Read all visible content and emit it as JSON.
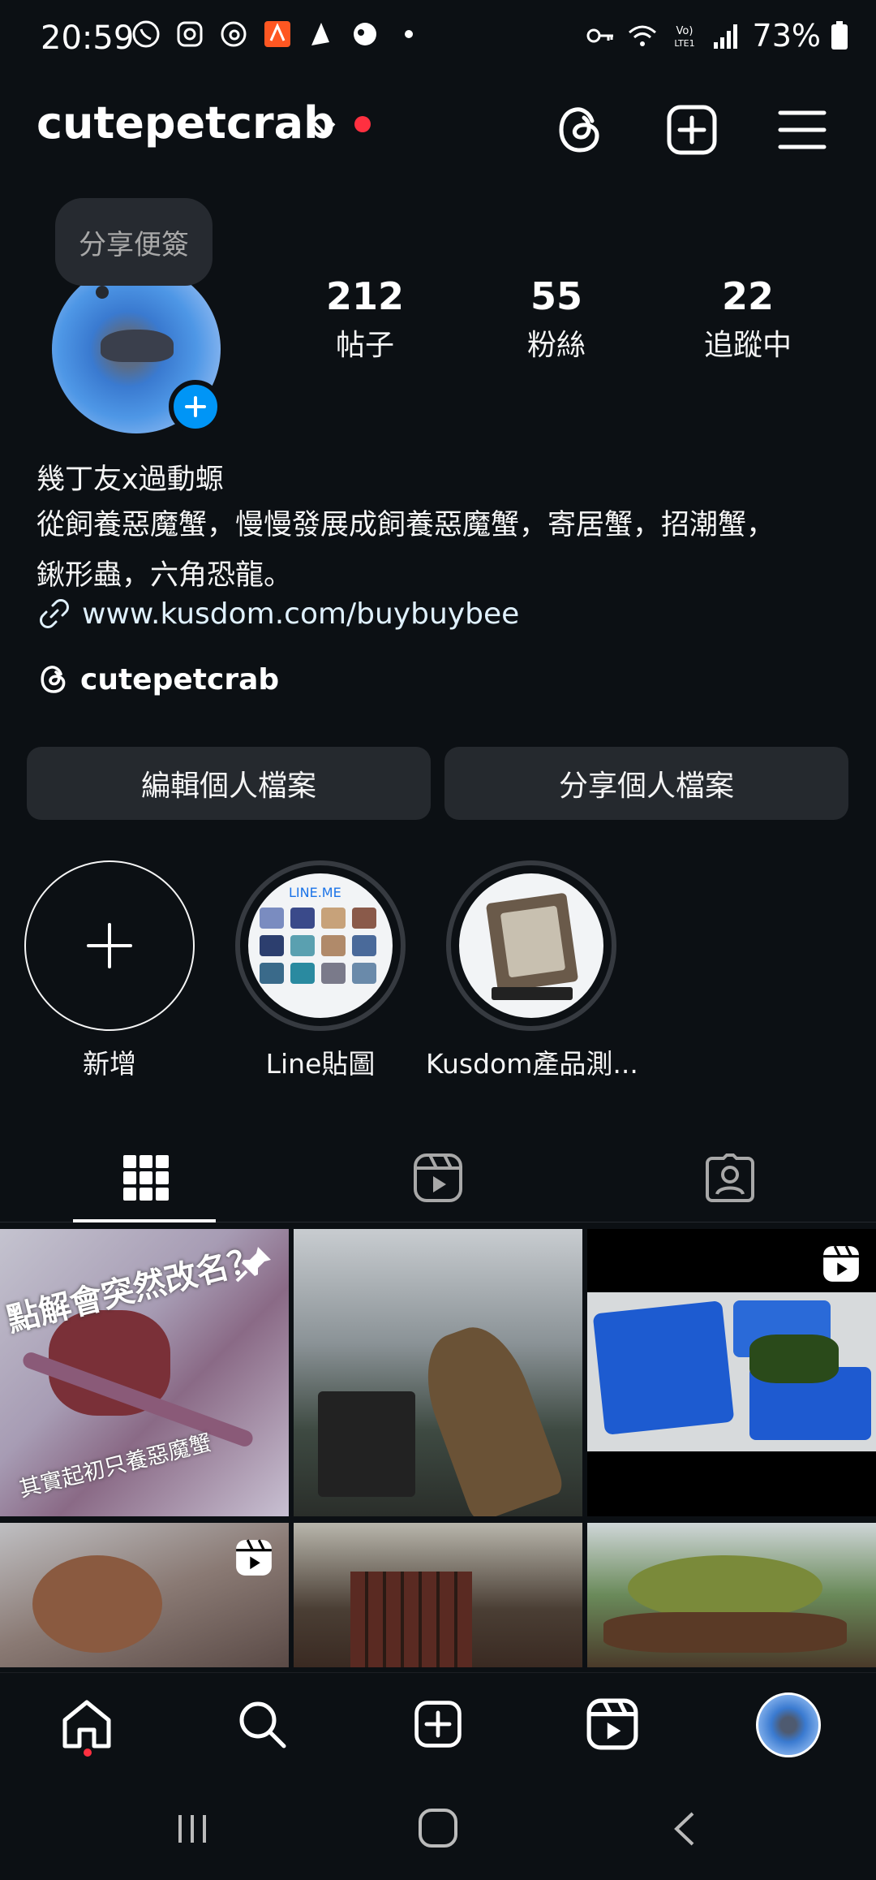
{
  "status_bar": {
    "time": "20:59",
    "battery": "73%",
    "app_icons": [
      "whatsapp-icon",
      "instagram-icon",
      "threads-icon",
      "app-icon",
      "app-icon",
      "app-icon",
      "more-dot-icon"
    ],
    "system_icons": [
      "key-icon",
      "wifi-icon",
      "volte-icon",
      "signal-icon",
      "battery-icon"
    ]
  },
  "header": {
    "username": "cutepetcrab",
    "icons": [
      "threads-icon",
      "add-post-icon",
      "menu-icon"
    ],
    "notification_color": "#ff3040"
  },
  "profile": {
    "note_prompt": "分享便簽",
    "stats": [
      {
        "value": "212",
        "label": "帖子"
      },
      {
        "value": "55",
        "label": "粉絲"
      },
      {
        "value": "22",
        "label": "追蹤中"
      }
    ],
    "name": "幾丁友x過動螈",
    "bio_line1": "從飼養惡魔蟹，慢慢發展成飼養惡魔蟹，寄居蟹，招潮蟹，",
    "bio_line2": "鍬形蟲，六角恐龍。",
    "link": "www.kusdom.com/buybuybee",
    "threads_handle": "cutepetcrab"
  },
  "buttons": {
    "edit_profile": "編輯個人檔案",
    "share_profile": "分享個人檔案"
  },
  "highlights": [
    {
      "label": "新增"
    },
    {
      "label": "Line貼圖",
      "caption": "LINE.ME"
    },
    {
      "label": "Kusdom產品測..."
    }
  ],
  "tabs": [
    "grid-icon",
    "reels-icon",
    "tagged-icon"
  ],
  "posts": [
    {
      "overlay_top": "點解會突然改名？",
      "overlay_bottom": "其實起初只養惡魔蟹",
      "badge": "pin-icon"
    },
    {
      "badge": ""
    },
    {
      "badge": "reel-icon"
    },
    {
      "badge": "reel-icon"
    },
    {
      "badge": ""
    },
    {
      "badge": ""
    }
  ],
  "bottom_nav": [
    "home-icon",
    "search-icon",
    "create-icon",
    "reels-icon",
    "profile-avatar"
  ],
  "colors": {
    "background": "#0c1014",
    "button": "#25292e",
    "accent_blue": "#0095f6",
    "notification_red": "#ff3040"
  }
}
